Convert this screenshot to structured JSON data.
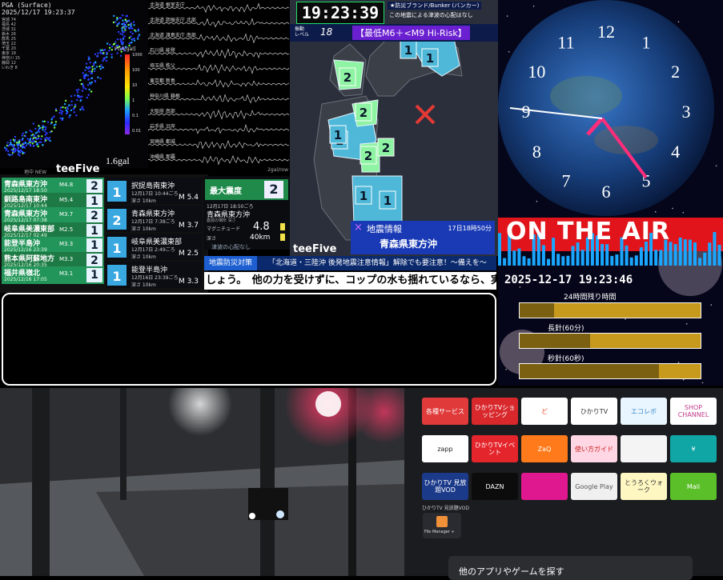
{
  "pga": {
    "title": "PGA (Surface)",
    "time": "2025/12/17 19:23:37",
    "stations": [
      "宮城 74",
      "福島 42",
      "茨城 31",
      "栃木 26",
      "群馬 25",
      "埼玉 22",
      "千葉 20",
      "東京 18",
      "神奈川 15",
      "静岡 12",
      "いわき 8"
    ],
    "scale_label": "PGA[gal]",
    "scale_ticks": [
      "1000",
      "100",
      "10",
      "1",
      "0.1",
      "0.01"
    ],
    "max_value": "1.6gal",
    "colors": [
      "#ff2a2a",
      "#ff9a00",
      "#ffe600",
      "#7cff4a",
      "#1aa0ff",
      "#2b2bff",
      "#8a2be2"
    ]
  },
  "waveform": {
    "stations": [
      "北海道 根室支庁",
      "北海道 胆振支庁 北部",
      "北海道 渡島支庁 南部",
      "石川県 能登",
      "埼玉県 秩父",
      "東京都 新島",
      "神奈川県 箱根",
      "大阪府 南部",
      "岩手県 沿岸",
      "宮崎県 都城",
      "沖縄県 那覇"
    ],
    "footer": "2gal/row"
  },
  "quake_list": {
    "header": "地中 NEW",
    "brand": "teeFive",
    "rows": [
      {
        "name": "青森県東方沖",
        "date": "2025/12/17 18:50",
        "mag": "M4.8",
        "shindo": "2"
      },
      {
        "name": "釧路島南東沖",
        "date": "2025/12/17 10:44",
        "mag": "M5.4",
        "shindo": "1"
      },
      {
        "name": "青森県東方沖",
        "date": "2025/12/17 07:38",
        "mag": "M3.7",
        "shindo": "2"
      },
      {
        "name": "岐阜県美濃東部",
        "date": "2025/12/17 02:49",
        "mag": "M2.5",
        "shindo": "1"
      },
      {
        "name": "能登半島沖",
        "date": "2025/12/16 23:39",
        "mag": "M3.3",
        "shindo": "1"
      },
      {
        "name": "熊本県阿蘇地方",
        "date": "2025/12/16 20:35",
        "mag": "M3.3",
        "shindo": "2"
      },
      {
        "name": "福井県嶺北",
        "date": "2025/12/16 17:05",
        "mag": "M3.1",
        "shindo": "1"
      }
    ],
    "cards": [
      {
        "name": "択捉島南東沖",
        "date": "12月17日 10:44ごろ",
        "depth": "深さ 10km",
        "mag": "M 5.4",
        "shindo": "1"
      },
      {
        "name": "青森県東方沖",
        "date": "12月17日 7:38ごろ",
        "depth": "深さ 10km",
        "mag": "M 3.7",
        "shindo": "2"
      },
      {
        "name": "岐阜県美濃東部",
        "date": "12月17日 2:49ごろ",
        "depth": "深さ 10km",
        "mag": "M 2.5",
        "shindo": "1"
      },
      {
        "name": "能登半島沖",
        "date": "12月16日 23:39ごろ",
        "depth": "深さ 10km",
        "mag": "M 3.3",
        "shindo": "1"
      }
    ],
    "shindo_label": "震度"
  },
  "info_box": {
    "max_intensity_label": "最大震度",
    "max_intensity": "2",
    "time": "12月17日 18:50ごろ",
    "place": "青森県東方沖",
    "note": "震源の場所 深さ",
    "magnitude_label": "マグニチュード",
    "magnitude": "4.8",
    "depth_label": "深さ",
    "depth": "40km",
    "tsunami": "津波の心配なし"
  },
  "tickers": {
    "tag": "地震防災対策",
    "headline": "「北海道・三陸沖 後発地震注意情報」解除でも要注意！〜備えを〜",
    "scroll": "しょう。　他の力を受けずに、コップの水も揺れているなら、実際に揺"
  },
  "map": {
    "time": "19:23:39",
    "brand_top": "★防災ブランド/Bunker (バンカー)",
    "notice": "この地震による津波の心配はなし",
    "level_label": "振動\nレベル",
    "level": "18",
    "risk": "【最低M6＋<M9 Hi-Risk】",
    "brand": "teeFive",
    "info_title": "地震情報",
    "info_time": "17日18時50分",
    "info_place": "青森県東方沖",
    "shindo_marks": [
      "2",
      "1",
      "1",
      "2",
      "2",
      "1",
      "2",
      "1",
      "1",
      "1"
    ]
  },
  "clock": {
    "on_air": "ON THE AIR",
    "datetime": "2025-12-17 19:23:46",
    "numerals": [
      "12",
      "1",
      "2",
      "3",
      "4",
      "5",
      "6",
      "7",
      "8",
      "9",
      "10",
      "11"
    ],
    "bars": [
      {
        "label": "24時間残り時間",
        "fill": 0.19
      },
      {
        "label": "長針(60分)",
        "fill": 0.39
      },
      {
        "label": "秒針(60秒)",
        "fill": 0.77
      }
    ]
  },
  "apps": {
    "tiles": [
      {
        "label": "各種サービス",
        "bg": "#e03a3a",
        "fg": "#fff"
      },
      {
        "label": "ひかりTVショッピング",
        "bg": "#d8282c",
        "fg": "#fff"
      },
      {
        "label": "ど",
        "bg": "#ffffff",
        "fg": "#e23c1e"
      },
      {
        "label": "ひかりTV",
        "bg": "#ffffff",
        "fg": "#333"
      },
      {
        "label": "エコレボ",
        "bg": "#e9f6ff",
        "fg": "#3a88c8"
      },
      {
        "label": "SHOP CHANNEL",
        "bg": "#ffffff",
        "fg": "#c23a8a"
      },
      {
        "label": "zapp",
        "bg": "#ffffff",
        "fg": "#222"
      },
      {
        "label": "ひかりTVイベント",
        "bg": "#e4252b",
        "fg": "#fff"
      },
      {
        "label": "ZaQ",
        "bg": "#ff7a1a",
        "fg": "#fff"
      },
      {
        "label": "使い方ガイド",
        "bg": "#ffd6e4",
        "fg": "#c22"
      },
      {
        "label": "",
        "bg": "#f4f4f4",
        "fg": "#333"
      },
      {
        "label": "¥",
        "bg": "#10a6a6",
        "fg": "#fff"
      },
      {
        "label": "ひかりTV 見放題VOD",
        "bg": "#1c3a8a",
        "fg": "#fff"
      },
      {
        "label": "DAZN",
        "bg": "#0c0c0c",
        "fg": "#fff"
      },
      {
        "label": "",
        "bg": "#e01890",
        "fg": "#fff"
      },
      {
        "label": "Google Play",
        "bg": "#f0f0f0",
        "fg": "#555"
      },
      {
        "label": "とうろくウォーク",
        "bg": "#fff7c2",
        "fg": "#333"
      },
      {
        "label": "Mail",
        "bg": "#5bbf2a",
        "fg": "#fff"
      }
    ],
    "vod_caption": "ひかりTV 見放題VOD",
    "file_manager": "File Manager +",
    "search_label": "他のアプリやゲームを探す"
  }
}
